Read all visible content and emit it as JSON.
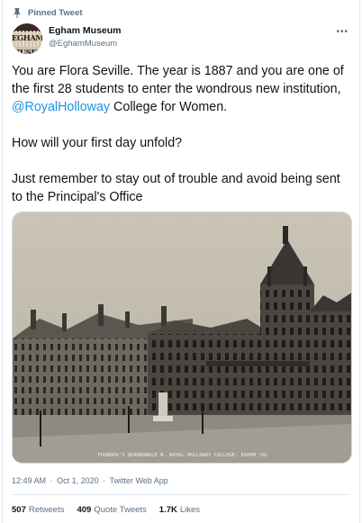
{
  "pinned_label": "Pinned Tweet",
  "author": {
    "name": "Egham Museum",
    "handle": "@EghamMuseum",
    "avatar_text": "EGHAM MUSEUM"
  },
  "tweet": {
    "text_1_before": "You are Flora Seville. The year is 1887 and you are one of the first 28 students to enter the wondrous new institution, ",
    "mention": "@RoyalHolloway",
    "text_1_after": " College for Women.",
    "text_2": "How will your first day unfold?",
    "text_3": "Just remember to stay out of trouble and avoid being sent to the Principal's Office",
    "photo_caption": "FOUNDER'S QUADRANGLE N. ROYAL HOLLOWAY COLLEGE, EGHAM (N)"
  },
  "meta": {
    "time": "12:49 AM",
    "separator": "·",
    "date": "Oct 1, 2020",
    "client": "Twitter Web App"
  },
  "stats": {
    "retweets_count": "507",
    "retweets_label": "Retweets",
    "quotes_count": "409",
    "quotes_label": "Quote Tweets",
    "likes_count": "1.7K",
    "likes_label": "Likes"
  }
}
